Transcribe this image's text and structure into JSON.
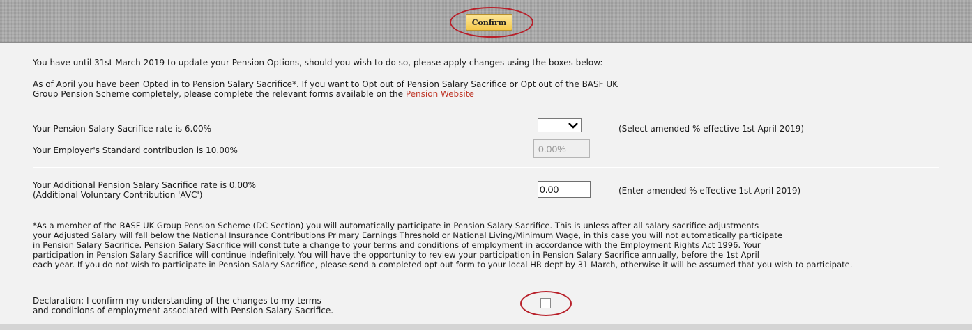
{
  "toolbar": {
    "confirm_label": "Confirm"
  },
  "intro": {
    "deadline_text": "You have until 31st March 2019 to update your Pension Options, should you wish to do so, please apply changes using the boxes below:",
    "optin_line1": "As of April you have been Opted in to Pension Salary Sacrifice*. If you want to Opt out of Pension Salary Sacrifice or Opt out of the BASF UK",
    "optin_line2_prefix": "Group Pension Scheme completely, please complete the relevant forms available on the ",
    "pension_link": "Pension Website"
  },
  "salary_sacrifice": {
    "label": "Your Pension Salary Sacrifice rate is 6.00%",
    "selected_value": "",
    "hint": "(Select amended % effective 1st April 2019)"
  },
  "employer": {
    "label": "Your Employer's Standard contribution is 10.00%",
    "value": "0.00%"
  },
  "additional": {
    "label_line1": "Your Additional Pension Salary Sacrifice rate is 0.00%",
    "label_line2": "(Additional Voluntary Contribution 'AVC')",
    "value": "0.00",
    "hint": "(Enter amended % effective 1st April 2019)"
  },
  "footnote": {
    "lines": [
      "*As a member of the BASF UK Group Pension Scheme (DC Section) you will automatically participate in Pension Salary Sacrifice. This is unless after all salary sacrifice adjustments",
      "your Adjusted Salary will fall below the National Insurance Contributions Primary Earnings Threshold or National Living/Minimum Wage, in this case you will not automatically participate",
      "in Pension Salary Sacrifice. Pension Salary Sacrifice will constitute a change to your terms and conditions of employment in accordance with the Employment Rights Act 1996. Your",
      "participation in Pension Salary Sacrifice will continue indefinitely. You will have the opportunity to review your participation in Pension Salary Sacrifice annually, before the 1st April",
      "each year. If you do not wish to participate in Pension Salary Sacrifice, please send a completed opt out form to your local HR dept by 31 March, otherwise it will be assumed that you wish to participate."
    ]
  },
  "declaration": {
    "line1": "Declaration: I confirm my understanding of the changes to my terms",
    "line2": "and conditions of employment associated with Pension Salary Sacrifice.",
    "checked": false
  },
  "colors": {
    "annotation_ring": "#b8202a",
    "link": "#c0392b",
    "button": "#f5c94a"
  }
}
